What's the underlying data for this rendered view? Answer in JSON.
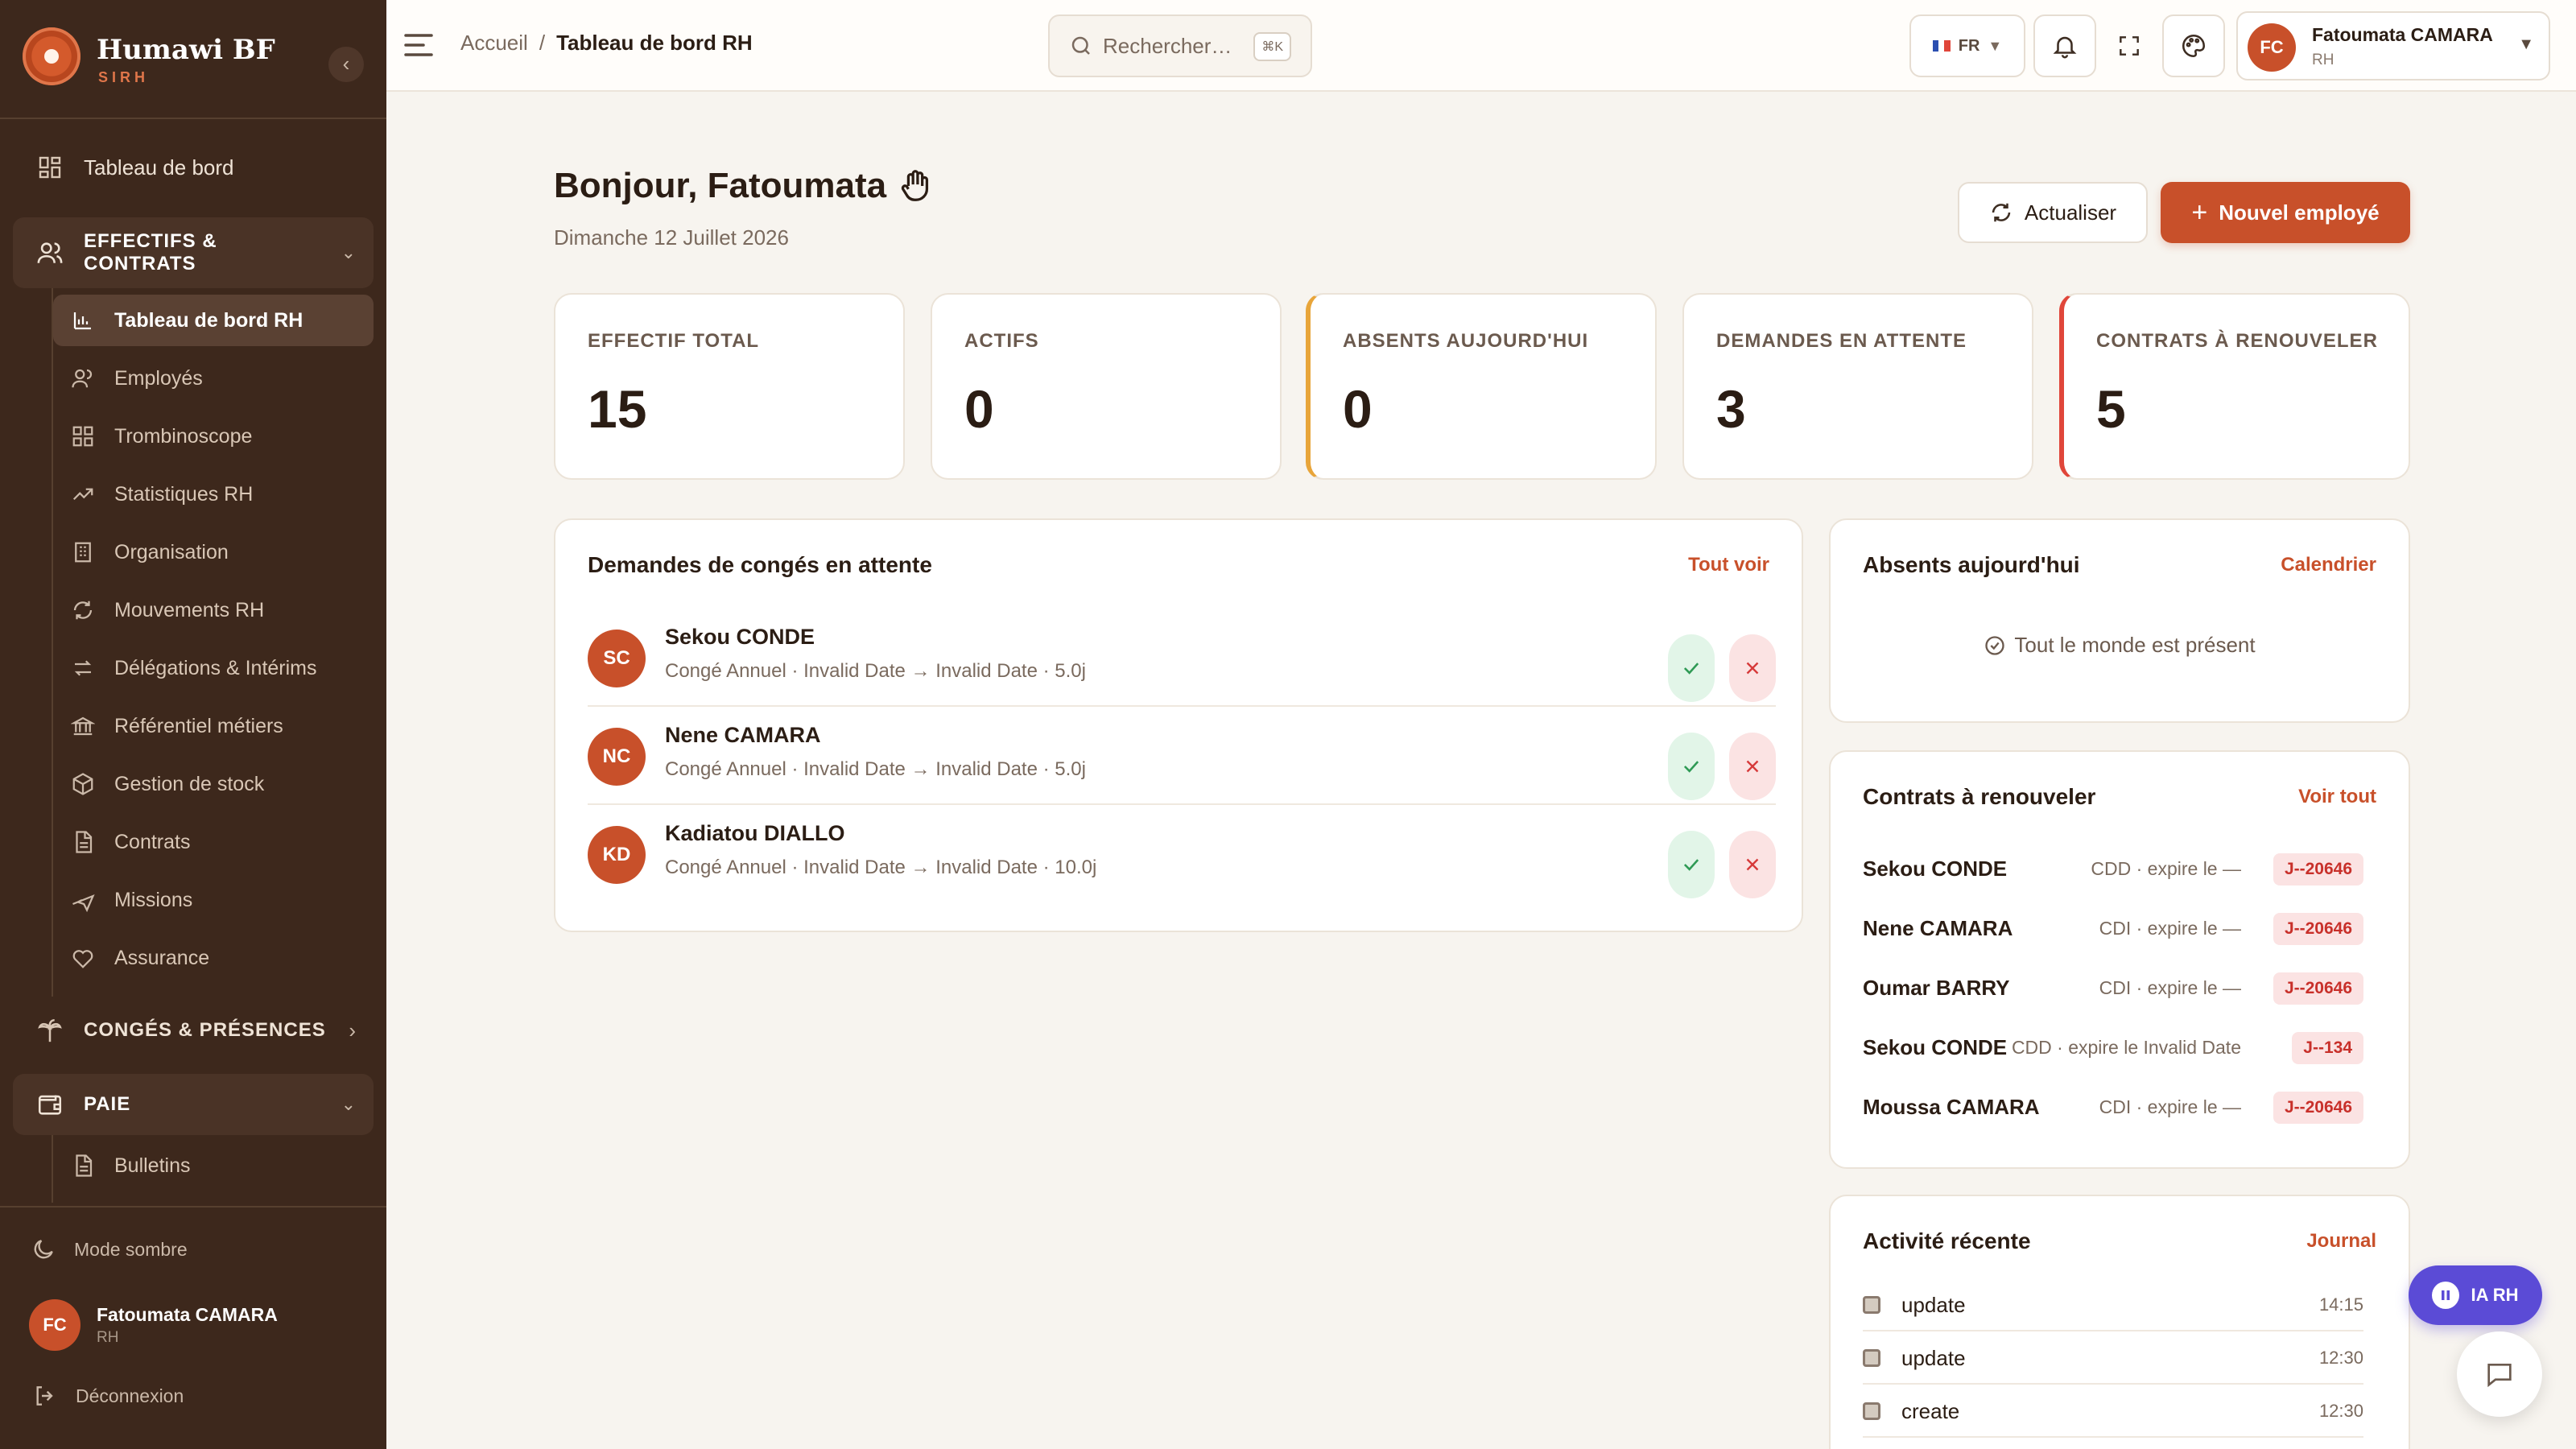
{
  "brand": {
    "name": "Humawi BF",
    "subtitle": "SIRH"
  },
  "sidebar": {
    "top_item": "Tableau de bord",
    "group_effectifs": "EFFECTIFS & CONTRATS",
    "sub_items": [
      {
        "label": "Tableau de bord RH",
        "icon": "bar-chart-icon"
      },
      {
        "label": "Employés",
        "icon": "users-icon"
      },
      {
        "label": "Trombinoscope",
        "icon": "grid-icon"
      },
      {
        "label": "Statistiques RH",
        "icon": "trend-icon"
      },
      {
        "label": "Organisation",
        "icon": "building-icon"
      },
      {
        "label": "Mouvements RH",
        "icon": "refresh-icon"
      },
      {
        "label": "Délégations & Intérims",
        "icon": "swap-icon"
      },
      {
        "label": "Référentiel métiers",
        "icon": "bank-icon"
      },
      {
        "label": "Gestion de stock",
        "icon": "box-icon"
      },
      {
        "label": "Contrats",
        "icon": "document-icon"
      },
      {
        "label": "Missions",
        "icon": "plane-icon"
      },
      {
        "label": "Assurance",
        "icon": "heart-icon"
      }
    ],
    "group_conges": "CONGÉS & PRÉSENCES",
    "group_paie": "PAIE",
    "paie_items": [
      {
        "label": "Bulletins",
        "icon": "document-icon"
      }
    ],
    "dark_mode": "Mode sombre",
    "user": {
      "initials": "FC",
      "name": "Fatoumata CAMARA",
      "role": "RH"
    },
    "logout": "Déconnexion"
  },
  "topbar": {
    "breadcrumb": {
      "home": "Accueil",
      "sep": "/",
      "current": "Tableau de bord RH"
    },
    "search_placeholder": "Rechercher…",
    "search_shortcut": "⌘K",
    "lang": "FR",
    "user": {
      "initials": "FC",
      "name": "Fatoumata CAMARA",
      "role": "RH"
    }
  },
  "header": {
    "greeting": "Bonjour, Fatoumata",
    "date": "Dimanche 12 Juillet 2026",
    "refresh_label": "Actualiser",
    "new_employee_label": "Nouvel employé"
  },
  "stats": [
    {
      "label": "EFFECTIF TOTAL",
      "value": "15"
    },
    {
      "label": "ACTIFS",
      "value": "0"
    },
    {
      "label": "ABSENTS AUJOURD'HUI",
      "value": "0"
    },
    {
      "label": "DEMANDES EN ATTENTE",
      "value": "3"
    },
    {
      "label": "CONTRATS À RENOUVELER",
      "value": "5"
    }
  ],
  "leave_requests": {
    "title": "Demandes de congés en attente",
    "link": "Tout voir",
    "items": [
      {
        "initials": "SC",
        "name": "Sekou CONDE",
        "info": "Congé Annuel · Invalid Date → Invalid Date · 5.0j"
      },
      {
        "initials": "NC",
        "name": "Nene CAMARA",
        "info": "Congé Annuel · Invalid Date → Invalid Date · 5.0j"
      },
      {
        "initials": "KD",
        "name": "Kadiatou DIALLO",
        "info": "Congé Annuel · Invalid Date → Invalid Date · 10.0j"
      }
    ]
  },
  "absents": {
    "title": "Absents aujourd'hui",
    "link": "Calendrier",
    "empty": "Tout le monde est présent"
  },
  "contracts": {
    "title": "Contrats à renouveler",
    "link": "Voir tout",
    "items": [
      {
        "name": "Sekou CONDE",
        "type": "CDD · expire le —",
        "tag": "J--20646"
      },
      {
        "name": "Nene CAMARA",
        "type": "CDI · expire le —",
        "tag": "J--20646"
      },
      {
        "name": "Oumar BARRY",
        "type": "CDI · expire le —",
        "tag": "J--20646"
      },
      {
        "name": "Sekou CONDE",
        "type": "CDD · expire le Invalid Date",
        "tag": "J--134"
      },
      {
        "name": "Moussa CAMARA",
        "type": "CDI · expire le —",
        "tag": "J--20646"
      }
    ]
  },
  "activity": {
    "title": "Activité récente",
    "link": "Journal",
    "items": [
      {
        "action": "update",
        "time": "14:15"
      },
      {
        "action": "update",
        "time": "12:30"
      },
      {
        "action": "create",
        "time": "12:30"
      }
    ]
  },
  "ia_button": "IA RH",
  "colors": {
    "accent": "#c8502a",
    "sidebar": "#3d281c",
    "warning": "#e8a53a",
    "danger": "#e0463a",
    "ia": "#5b4bd6"
  }
}
